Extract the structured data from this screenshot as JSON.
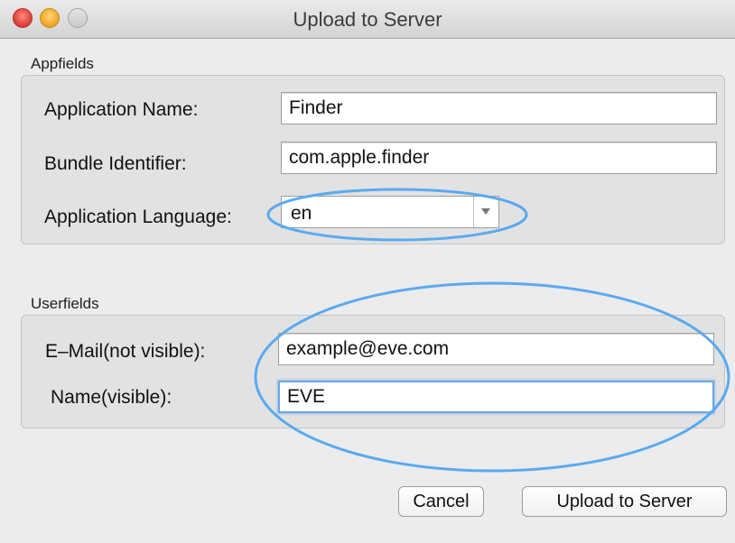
{
  "window": {
    "title": "Upload to Server"
  },
  "appfields": {
    "group_label": "Appfields",
    "application_name": {
      "label": "Application Name:",
      "value": "Finder"
    },
    "bundle_identifier": {
      "label": "Bundle Identifier:",
      "value": "com.apple.finder"
    },
    "application_language": {
      "label": "Application Language:",
      "value": "en"
    }
  },
  "userfields": {
    "group_label": "Userfields",
    "email": {
      "label": "E–Mail(not visible):",
      "value": "example@eve.com"
    },
    "name": {
      "label": "Name(visible):",
      "value": "EVE"
    }
  },
  "buttons": {
    "cancel": "Cancel",
    "upload": "Upload to Server"
  },
  "colors": {
    "annotation_ellipse": "#5aaaf0",
    "focus_ring": "#6aa9ea"
  }
}
